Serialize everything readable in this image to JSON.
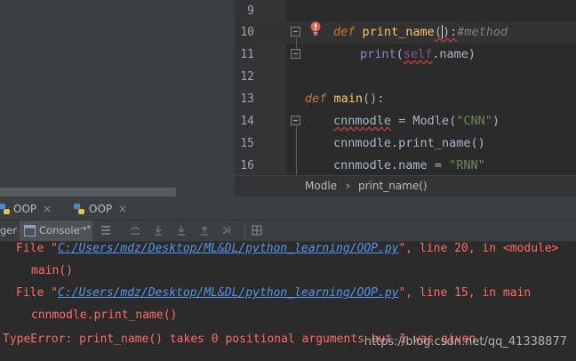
{
  "editor": {
    "lines": [
      {
        "num": "9"
      },
      {
        "num": "10",
        "kw": "def",
        "fn": "print_name",
        "open": "(",
        "close": "):",
        "comment": "#method"
      },
      {
        "num": "11",
        "call": "print",
        "open": "(",
        "self": "self",
        "rest": ".name)"
      },
      {
        "num": "12"
      },
      {
        "num": "13",
        "kw": "def",
        "fn": "main",
        "rest": "():"
      },
      {
        "num": "14",
        "var": "cnnmodle",
        "eq": " = ",
        "call": "Modle",
        "open": "(",
        "str": "\"CNN\"",
        "close": ")"
      },
      {
        "num": "15",
        "var": "cnnmodle",
        "dot": ".",
        "call": "print_name",
        "rest": "()"
      },
      {
        "num": "16",
        "var": "cnnmodle",
        "rest": ".name",
        "eq": " = ",
        "str": "\"RNN\""
      }
    ]
  },
  "breadcrumb": {
    "class_name": "Modle",
    "separator": "›",
    "method_name": "print_name()"
  },
  "run_tabs": [
    {
      "label": "OOP",
      "close": "×",
      "icon": "python-icon"
    },
    {
      "label": "OOP",
      "close": "×",
      "icon": "python-icon"
    }
  ],
  "toolbar": {
    "debugger_label": "ger",
    "console_label": "Console",
    "pin": "→*"
  },
  "console": {
    "line1_prefix": "File \"",
    "line1_path": "C:/Users/mdz/Desktop/ML&DL/python_learning/OOP.py",
    "line1_suffix": "\", line 20, in <module>",
    "line2": "main()",
    "line3_prefix": "File \"",
    "line3_path": "C:/Users/mdz/Desktop/ML&DL/python_learning/OOP.py",
    "line3_suffix": "\", line 15, in main",
    "line4": "cnnmodle.print_name()",
    "line5": "TypeError: print_name() takes 0 positional arguments but 1 was given"
  },
  "watermark": "https://blog.csdn.net/qq_41338877",
  "colors": {
    "error": "#ff6b68",
    "link": "#5394ec",
    "keyword": "#cc7832",
    "string": "#6a8759",
    "function": "#ffc66d"
  }
}
